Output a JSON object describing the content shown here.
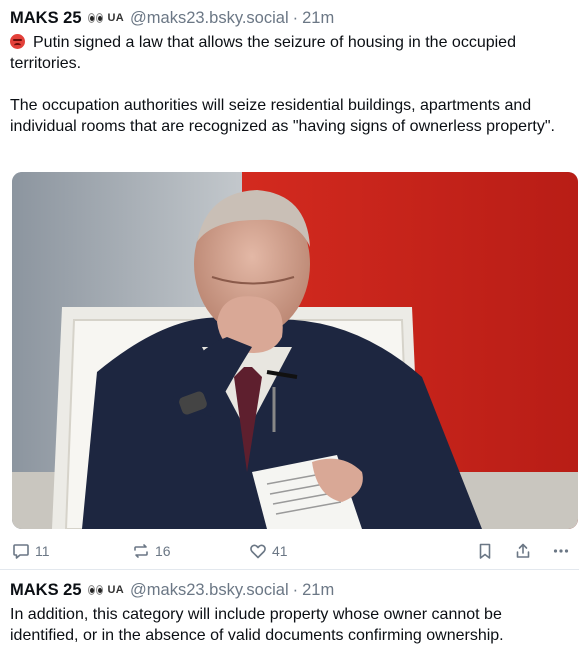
{
  "posts": [
    {
      "author": {
        "name": "MAKS 25",
        "flag": "UA",
        "handle": "@maks23.bsky.social",
        "time": "21m"
      },
      "paragraphs": [
        "Putin signed a law that allows the seizure of housing in the occupied territories.",
        "The occupation authorities will seize residential buildings, apartments and individual rooms that are recognized as \"having signs of ownerless property\"."
      ],
      "stats": {
        "replies": "11",
        "reposts": "16",
        "likes": "41"
      }
    },
    {
      "author": {
        "name": "MAKS 25",
        "flag": "UA",
        "handle": "@maks23.bsky.social",
        "time": "21m"
      },
      "paragraphs": [
        "In addition, this category will include property whose owner cannot be identified, or in the absence of valid documents confirming ownership."
      ]
    }
  ],
  "separator": "·",
  "colors": {
    "text": "#0b0f14",
    "muted": "#6b7785",
    "divider": "#e3e8ee",
    "angry_emoji": "#e3413a"
  },
  "icons": [
    "angry-face-icon",
    "eyes-icon",
    "reply-icon",
    "repost-icon",
    "like-icon",
    "bookmark-icon",
    "share-icon",
    "more-icon"
  ]
}
